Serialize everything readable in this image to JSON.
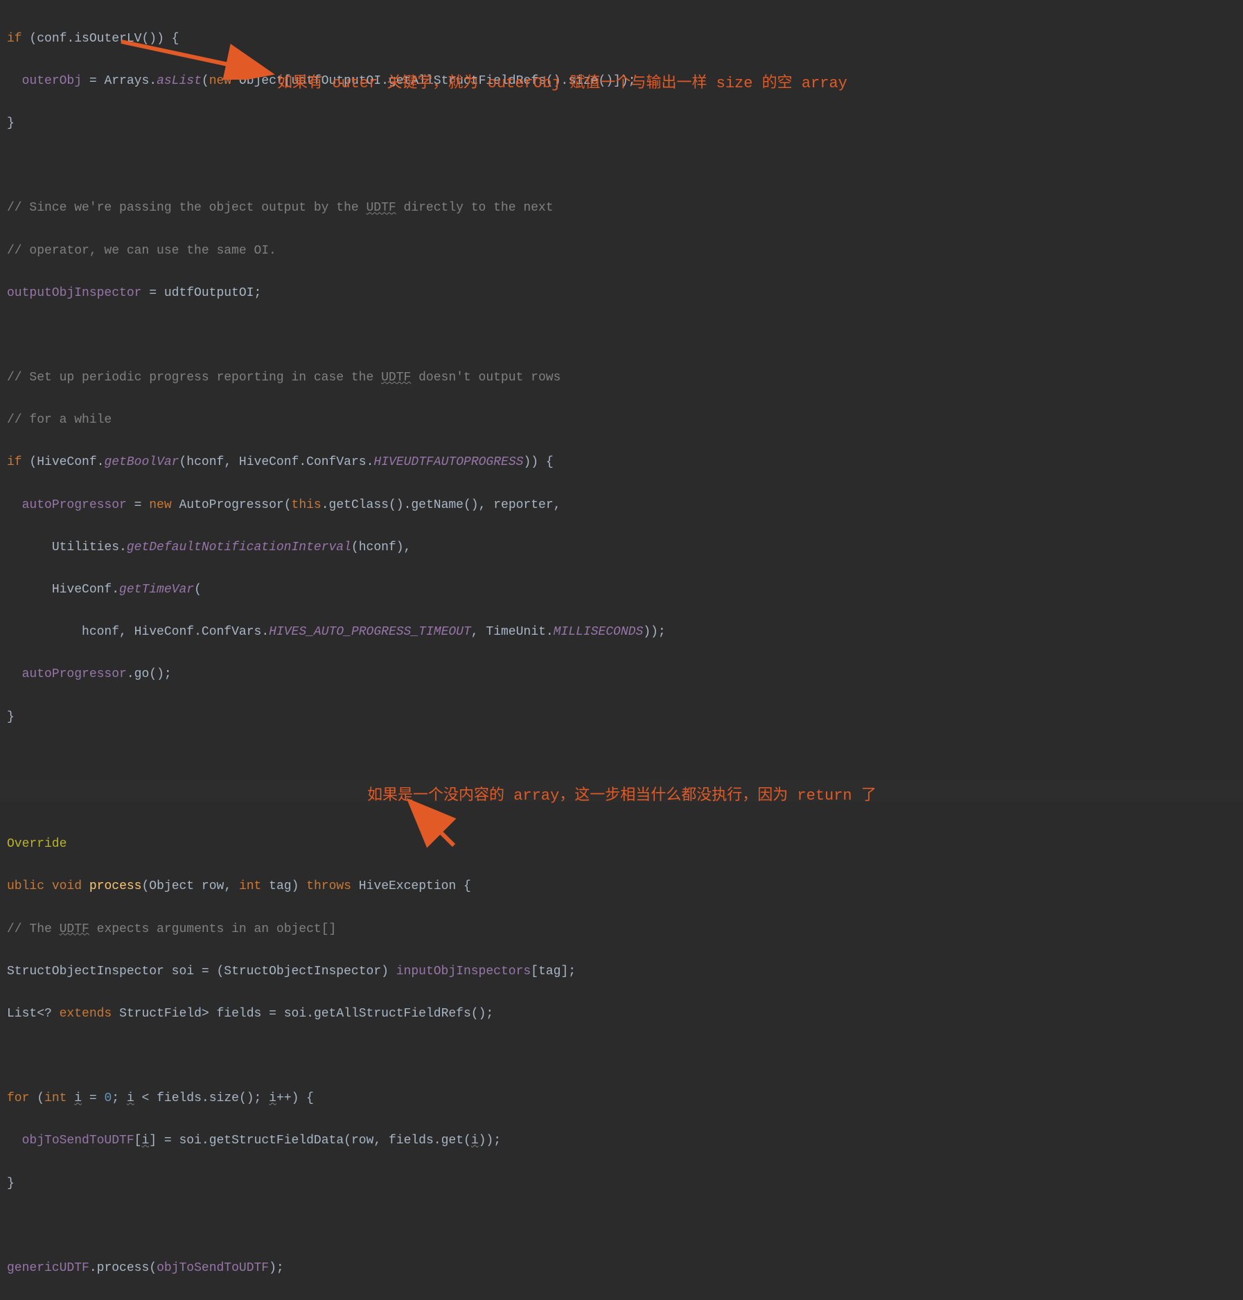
{
  "code": {
    "l1": {
      "kw_if": "if",
      "p1": " (",
      "obj1": "conf",
      "p2": ".",
      "m1": "isOuterLV",
      "p3": "()) {"
    },
    "l2": {
      "sp": "  ",
      "var1": "outerObj",
      "eq": " = ",
      "cls1": "Arrays",
      "dot1": ".",
      "sm1": "asList",
      "p1": "(",
      "kw_new": "new",
      "sp2": " ",
      "cls2": "Object",
      "p2": "[",
      "obj2": "udtfOutputOI",
      "dot2": ".",
      "m2": "getAllStructFieldRefs",
      "p3": "().",
      "m3": "size",
      "p4": "()]);"
    },
    "l3": {
      "brace": "}"
    },
    "l5": {
      "c1": "// Since we're passing the object output by the ",
      "wavy1": "UDTF",
      "c2": " directly to the next"
    },
    "l6": {
      "c1": "// operator, we can use the same OI."
    },
    "l7": {
      "var1": "outputObjInspector",
      "eq": " = ",
      "var2": "udtfOutputOI",
      "semi": ";"
    },
    "l9": {
      "c1": "// Set up periodic progress reporting in case the ",
      "wavy1": "UDTF",
      "c2": " doesn't output rows"
    },
    "l10": {
      "c1": "// for a while"
    },
    "l11": {
      "kw_if": "if",
      "p1": " (",
      "cls1": "HiveConf",
      "dot1": ".",
      "sm1": "getBoolVar",
      "p2": "(",
      "var1": "hconf",
      "comma1": ", ",
      "cls2": "HiveConf",
      "dot2": ".",
      "inner1": "ConfVars",
      "dot3": ".",
      "const1": "HIVEUDTFAUTOPROGRESS",
      "p3": ")) {"
    },
    "l12": {
      "sp": "  ",
      "var1": "autoProgressor",
      "eq": " = ",
      "kw_new": "new",
      "sp2": " ",
      "cls1": "AutoProgressor",
      "p1": "(",
      "kw_this": "this",
      "dot1": ".",
      "m1": "getClass",
      "p2": "().",
      "m2": "getName",
      "p3": "(), ",
      "var2": "reporter",
      "comma": ","
    },
    "l13": {
      "sp": "      ",
      "cls1": "Utilities",
      "dot1": ".",
      "sm1": "getDefaultNotificationInterval",
      "p1": "(",
      "var1": "hconf",
      "p2": "),"
    },
    "l14": {
      "sp": "      ",
      "cls1": "HiveConf",
      "dot1": ".",
      "sm1": "getTimeVar",
      "p1": "("
    },
    "l15": {
      "sp": "          ",
      "var1": "hconf",
      "comma1": ", ",
      "cls1": "HiveConf",
      "dot1": ".",
      "inner1": "ConfVars",
      "dot2": ".",
      "const1": "HIVES_AUTO_PROGRESS_TIMEOUT",
      "comma2": ", ",
      "cls2": "TimeUnit",
      "dot3": ".",
      "const2": "MILLISECONDS",
      "p1": "));"
    },
    "l16": {
      "sp": "  ",
      "var1": "autoProgressor",
      "dot1": ".",
      "m1": "go",
      "p1": "();"
    },
    "l17": {
      "brace": "}"
    },
    "l20": {
      "anno": "Override"
    },
    "l21": {
      "kw1": "ublic",
      "sp1": " ",
      "kw2": "void",
      "sp2": " ",
      "m1": "process",
      "p1": "(",
      "cls1": "Object",
      "sp3": " ",
      "var1": "row",
      "comma1": ", ",
      "kw3": "int",
      "sp4": " ",
      "var2": "tag",
      "p2": ") ",
      "kw4": "throws",
      "sp5": " ",
      "cls2": "HiveException",
      "sp6": " {"
    },
    "l22": {
      "c1": "// The ",
      "wavy1": "UDTF",
      "c2": " expects arguments in an object[]"
    },
    "l23": {
      "cls1": "StructObjectInspector",
      "sp1": " ",
      "var1": "soi",
      "eq": " = (",
      "cls2": "StructObjectInspector",
      "p1": ") ",
      "fld1": "inputObjInspectors",
      "p2": "[",
      "var2": "tag",
      "p3": "];"
    },
    "l24": {
      "cls1": "List",
      "p1": "<? ",
      "kw1": "extends",
      "sp1": " ",
      "cls2": "StructField",
      "p2": "> ",
      "var1": "fields",
      "eq": " = ",
      "var2": "soi",
      "dot1": ".",
      "m1": "getAllStructFieldRefs",
      "p3": "();"
    },
    "l26": {
      "kw_for": "for",
      "p1": " (",
      "kw_int": "int",
      "sp1": " ",
      "var1": "i",
      "eq": " = ",
      "num1": "0",
      "semi1": "; ",
      "var2": "i",
      "cmp": " < ",
      "var3": "fields",
      "dot1": ".",
      "m1": "size",
      "p2": "(); ",
      "var4": "i",
      "inc": "++) {"
    },
    "l27": {
      "sp": "  ",
      "fld1": "objToSendToUDTF",
      "p1": "[",
      "var1": "i",
      "p2": "] = ",
      "var2": "soi",
      "dot1": ".",
      "m1": "getStructFieldData",
      "p3": "(",
      "var3": "row",
      "comma1": ", ",
      "var4": "fields",
      "dot2": ".",
      "m2": "get",
      "p4": "(",
      "var5": "i",
      "p5": "));"
    },
    "l28": {
      "brace": "}"
    },
    "l30": {
      "fld1": "genericUDTF",
      "dot1": ".",
      "m1": "process",
      "p1": "(",
      "fld2": "objToSendToUDTF",
      "p2": ");"
    }
  },
  "annotations": {
    "a1": "如果有 outer 关键字，就为 outerObj 赋值一个与输出一样 size 的空 array",
    "a2": "如果是一个没内容的 array，这一步相当什么都没执行，因为 return 了"
  }
}
